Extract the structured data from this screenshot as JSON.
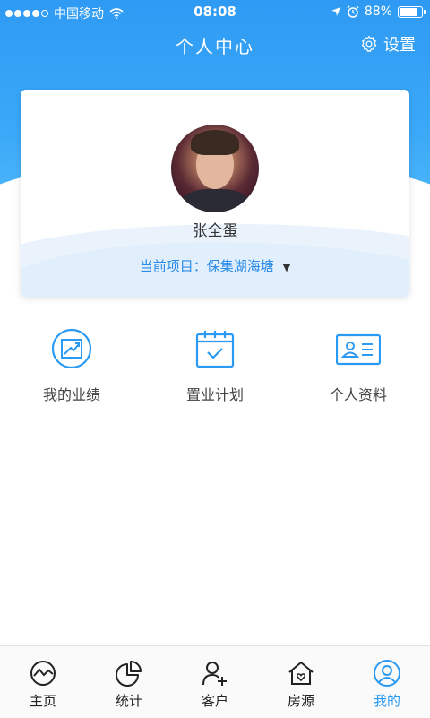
{
  "status_bar": {
    "carrier": "中国移动",
    "time": "08:08",
    "battery": "88%"
  },
  "header": {
    "title": "个人中心",
    "settings_label": "设置"
  },
  "profile": {
    "name": "张全蛋",
    "project_prefix": "当前项目：",
    "project_name": "保集湖海塘"
  },
  "quick_actions": [
    {
      "label": "我的业绩",
      "icon": "chart-trend-icon"
    },
    {
      "label": "置业计划",
      "icon": "calendar-check-icon"
    },
    {
      "label": "个人资料",
      "icon": "id-card-icon"
    }
  ],
  "tabs": [
    {
      "label": "主页",
      "icon": "home-trend-icon"
    },
    {
      "label": "统计",
      "icon": "pie-chart-icon"
    },
    {
      "label": "客户",
      "icon": "add-user-icon"
    },
    {
      "label": "房源",
      "icon": "house-heart-icon"
    },
    {
      "label": "我的",
      "icon": "profile-icon",
      "active": true
    }
  ],
  "colors": {
    "primary": "#2f9af3",
    "active_tab": "#2a9af3",
    "project_text": "#2a8be8"
  }
}
